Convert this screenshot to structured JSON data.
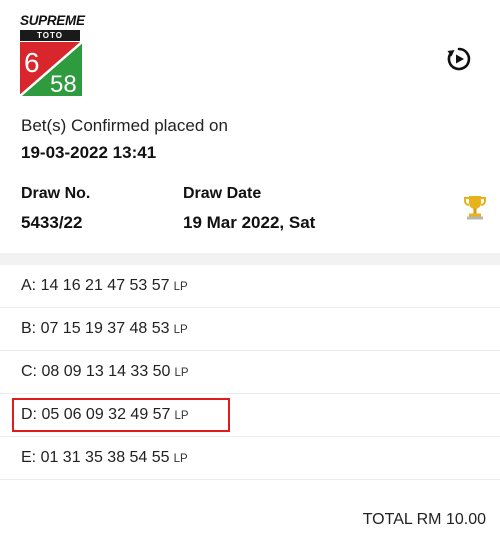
{
  "logo": {
    "brand": "SUPREME",
    "sub": "TOTO",
    "num_left": "6",
    "num_right": "58",
    "colors": {
      "red": "#d8262c",
      "green": "#2e9b3f"
    }
  },
  "confirmation": {
    "label": "Bet(s) Confirmed placed on",
    "datetime": "19-03-2022 13:41"
  },
  "draw": {
    "number_label": "Draw No.",
    "number_value": "5433/22",
    "date_label": "Draw Date",
    "date_value": "19 Mar 2022, Sat"
  },
  "icons": {
    "replay": "replay-icon",
    "trophy": "trophy-icon"
  },
  "bets": [
    {
      "text": "A: 14 16 21 47 53 57",
      "tag": "LP"
    },
    {
      "text": "B: 07 15 19 37 48 53",
      "tag": "LP"
    },
    {
      "text": "C: 08 09 13 14 33 50",
      "tag": "LP"
    },
    {
      "text": "D: 05 06 09 32 49 57",
      "tag": "LP"
    },
    {
      "text": "E: 01 31 35 38 54 55",
      "tag": "LP"
    }
  ],
  "total": "TOTAL RM 10.00",
  "highlight_color": "#e11b1b"
}
